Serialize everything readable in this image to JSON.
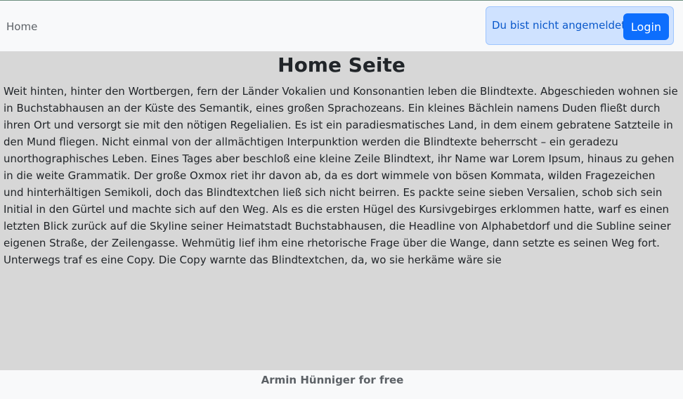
{
  "colors": {
    "navbar_background": "#f8f9fa",
    "main_background": "#d7d7d7",
    "alert_background": "#cfe2ff",
    "alert_text": "#0a58ca",
    "button_background": "#0d6efd",
    "text": "#212529",
    "muted_text": "#5c6166"
  },
  "navbar": {
    "home_link": "Home",
    "login_alert": {
      "text": "Du bist nicht angemeldet!",
      "button_label": "Login"
    }
  },
  "main": {
    "title": "Home Seite",
    "body": "Weit hinten, hinter den Wortbergen, fern der Länder Vokalien und Konsonantien leben die Blindtexte. Abgeschieden wohnen sie in Buchstabhausen an der Küste des Semantik, eines großen Sprachozeans. Ein kleines Bächlein namens Duden fließt durch ihren Ort und versorgt sie mit den nötigen Regelialien. Es ist ein paradiesmatisches Land, in dem einem gebratene Satzteile in den Mund fliegen. Nicht einmal von der allmächtigen Interpunktion werden die Blindtexte beherrscht – ein geradezu unorthographisches Leben. Eines Tages aber beschloß eine kleine Zeile Blindtext, ihr Name war Lorem Ipsum, hinaus zu gehen in die weite Grammatik. Der große Oxmox riet ihr davon ab, da es dort wimmele von bösen Kommata, wilden Fragezeichen und hinterhältigen Semikoli, doch das Blindtextchen ließ sich nicht beirren. Es packte seine sieben Versalien, schob sich sein Initial in den Gürtel und machte sich auf den Weg. Als es die ersten Hügel des Kursivgebirges erklommen hatte, warf es einen letzten Blick zurück auf die Skyline seiner Heimatstadt Buchstabhausen, die Headline von Alphabetdorf und die Subline seiner eigenen Straße, der Zeilengasse. Wehmütig lief ihm eine rhetorische Frage über die Wange, dann setzte es seinen Weg fort. Unterwegs traf es eine Copy. Die Copy warnte das Blindtextchen, da, wo sie herkäme wäre sie"
  },
  "footer": {
    "text": "Armin Hünniger for free"
  }
}
